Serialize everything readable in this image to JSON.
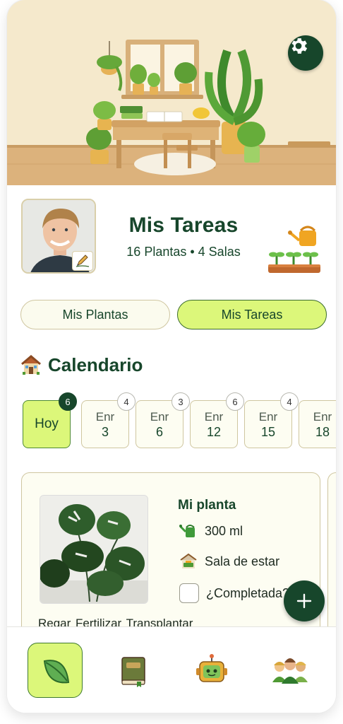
{
  "header": {
    "settings_icon": "gear-icon",
    "hero_image": "plant-room-illustration"
  },
  "profile": {
    "title": "Mis Tareas",
    "subtitle": "16 Plantas • 4 Salas",
    "avatar": "user-avatar",
    "edit_icon": "edit-pencil-icon",
    "decor_icon": "watering-can-seedlings-icon"
  },
  "tabs": [
    {
      "label": "Mis Plantas",
      "active": false
    },
    {
      "label": "Mis Tareas",
      "active": true
    }
  ],
  "calendar": {
    "icon": "house-icon",
    "title": "Calendario",
    "days": [
      {
        "label": "Hoy",
        "month": "",
        "day": "",
        "count": "6",
        "selected": true
      },
      {
        "label": "",
        "month": "Enr",
        "day": "3",
        "count": "4",
        "selected": false
      },
      {
        "label": "",
        "month": "Enr",
        "day": "6",
        "count": "3",
        "selected": false
      },
      {
        "label": "",
        "month": "Enr",
        "day": "12",
        "count": "6",
        "selected": false
      },
      {
        "label": "",
        "month": "Enr",
        "day": "15",
        "count": "4",
        "selected": false
      },
      {
        "label": "",
        "month": "Enr",
        "day": "18",
        "count": "",
        "selected": false
      }
    ]
  },
  "task": {
    "plant_name": "Mi planta",
    "water_amount": "300 ml",
    "room": "Sala de estar",
    "completed_label": "¿Completada?",
    "completed": false,
    "actions_text": "Regar   Fertilizar  Transplantar"
  },
  "colors": {
    "primary_dark": "#17462b",
    "accent_lime": "#dcf77a",
    "card_bg": "#fdfdf2",
    "card_border": "#cfc6a0"
  },
  "nav": [
    {
      "icon": "leaf-icon",
      "active": true
    },
    {
      "icon": "book-icon",
      "active": false
    },
    {
      "icon": "robot-icon",
      "active": false
    },
    {
      "icon": "community-icon",
      "active": false
    }
  ]
}
